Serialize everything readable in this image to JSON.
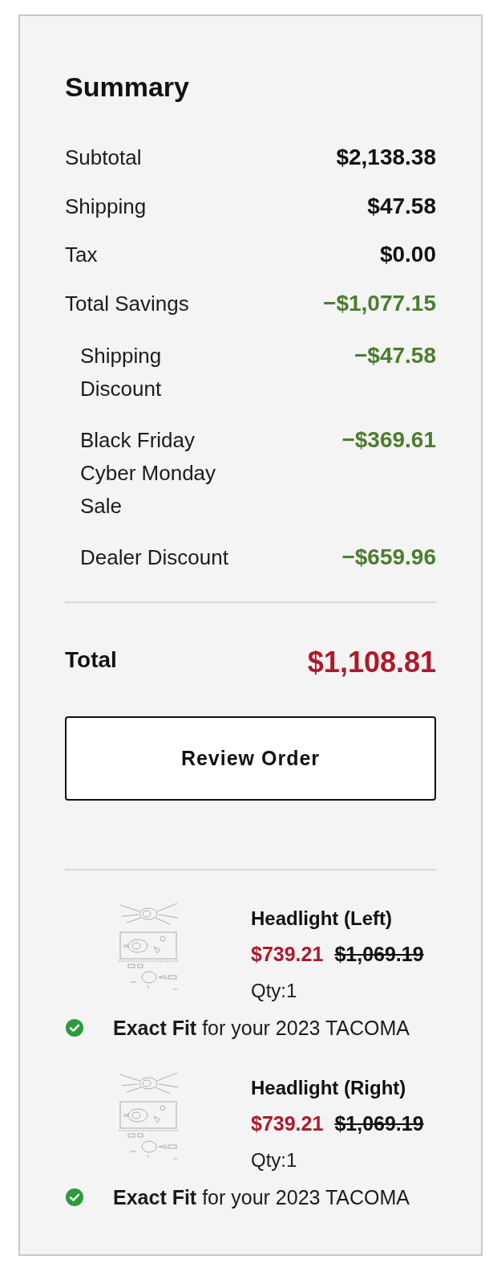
{
  "summary": {
    "title": "Summary",
    "lines": [
      {
        "label": "Subtotal",
        "amount": "$2,138.38",
        "kind": "charge"
      },
      {
        "label": "Shipping",
        "amount": "$47.58",
        "kind": "charge"
      },
      {
        "label": "Tax",
        "amount": "$0.00",
        "kind": "charge"
      },
      {
        "label": "Total Savings",
        "amount": "−$1,077.15",
        "kind": "savings",
        "children": [
          {
            "label": "Shipping Discount",
            "amount": "−$47.58",
            "kind": "savings"
          },
          {
            "label": "Black Friday Cyber Monday Sale",
            "amount": "−$369.61",
            "kind": "savings"
          },
          {
            "label": "Dealer Discount",
            "amount": "−$659.96",
            "kind": "savings"
          }
        ]
      }
    ],
    "total": {
      "label": "Total",
      "amount": "$1,108.81"
    },
    "review_button": {
      "label": "Review Order"
    }
  },
  "items": [
    {
      "name": "Headlight (Left)",
      "sale_price": "$739.21",
      "original_price": "$1,069.19",
      "quantity": "Qty:1",
      "fitment": "**Exact Fit** for your 2023 TACOMA"
    },
    {
      "name": "Headlight (Right)",
      "sale_price": "$739.21",
      "original_price": "$1,069.19",
      "quantity": "Qty:1",
      "fitment": "**Exact Fit** for your 2023 TACOMA"
    }
  ]
}
